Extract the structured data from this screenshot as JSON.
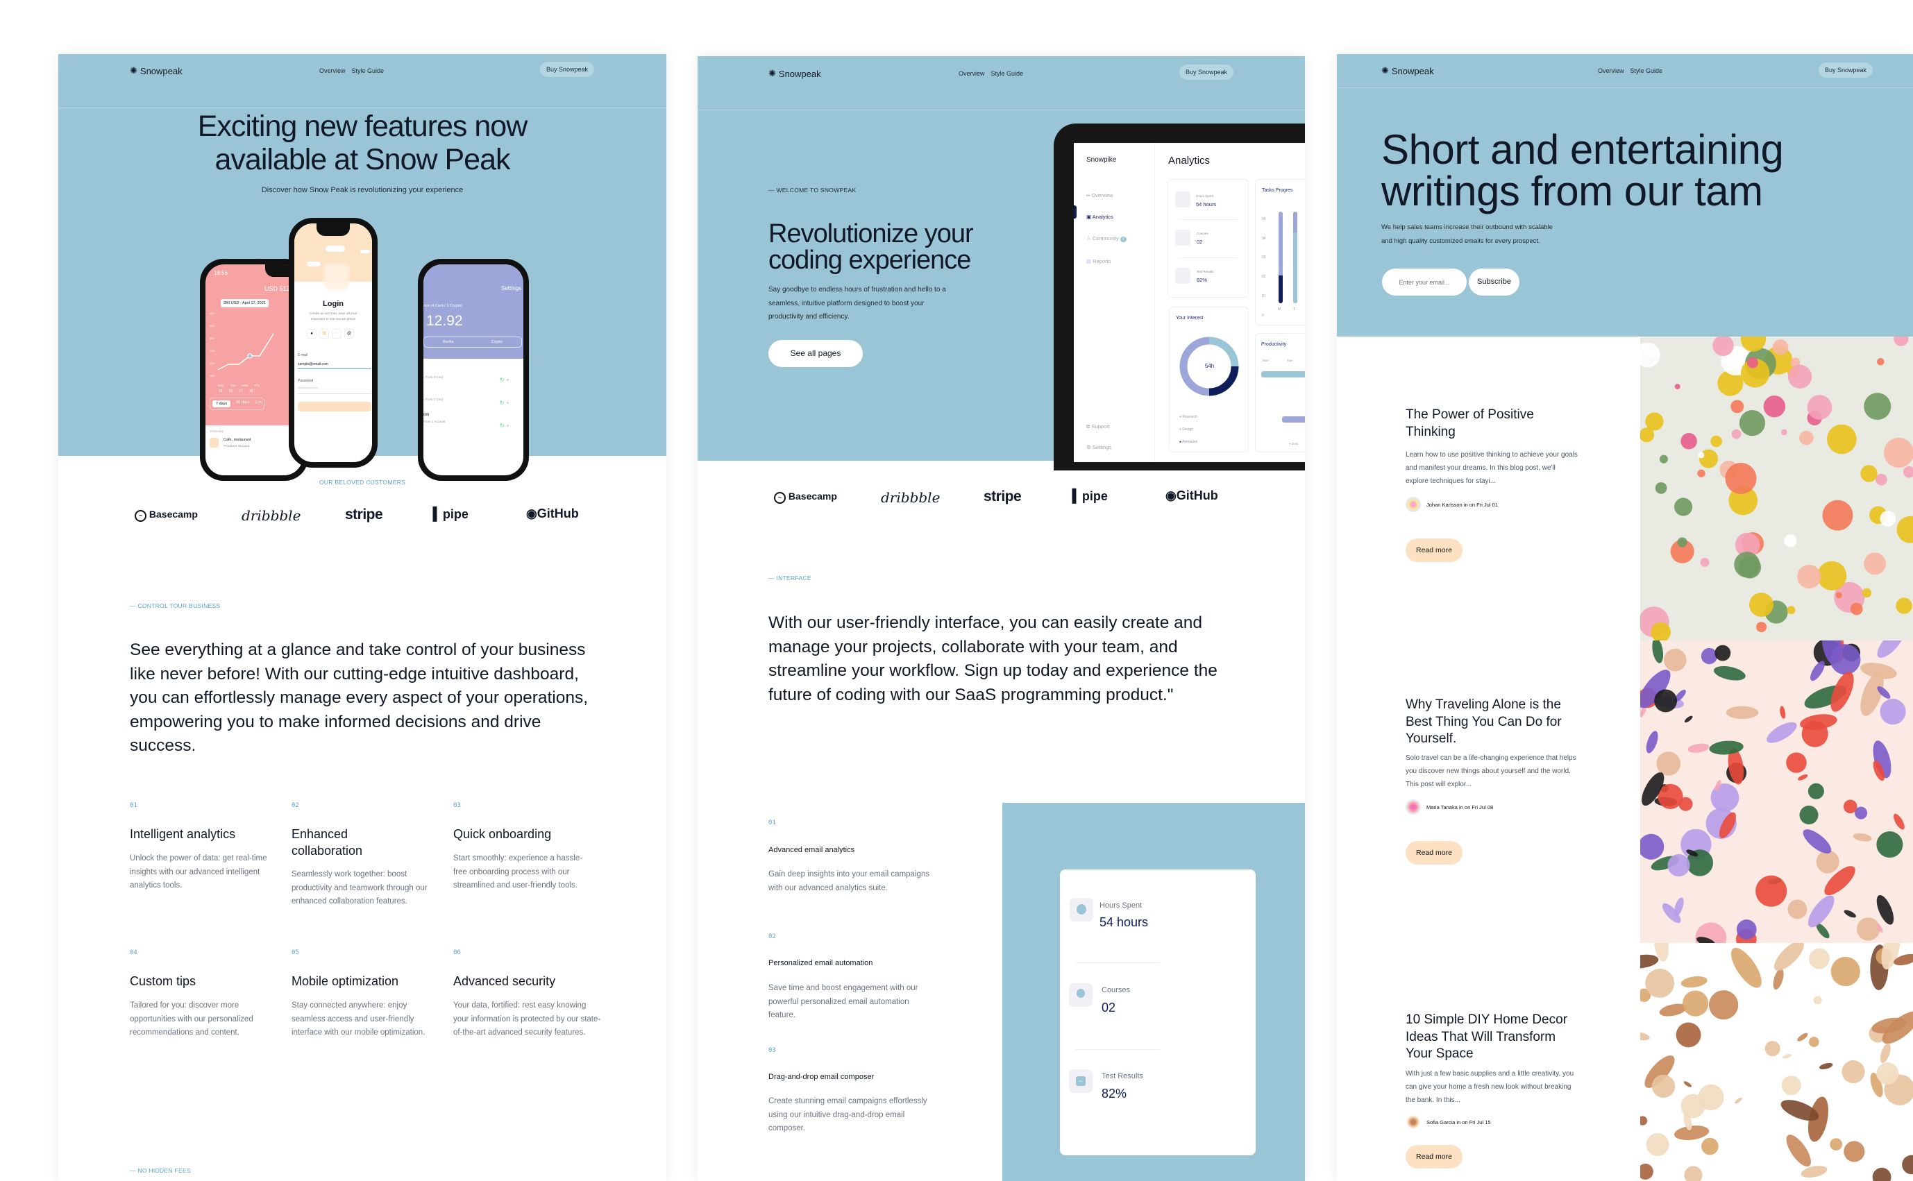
{
  "colors": {
    "brand_blue": "#9AC5D6",
    "accent_text": "#5AA3C2",
    "dark_navy": "#0F1E5A",
    "read_more_bg": "#FDE1C3"
  },
  "nav": {
    "logo": "Snowpeak",
    "links": [
      "Overview",
      "Style Guide"
    ],
    "cta": "Buy Snowpeak"
  },
  "customers": {
    "label": "OUR BELOVED CUSTOMERS",
    "logos": [
      "Basecamp",
      "dribbble",
      "stripe",
      "pipe",
      "GitHub"
    ]
  },
  "page1": {
    "hero_title_1": "Exciting new features now",
    "hero_title_2": "available at Snow Peak",
    "hero_subtitle": "Discover how Snow Peak is revolutionizing your experience",
    "phone_left": {
      "time": "18:56",
      "balance": "USD 512.92",
      "tooltip": "280 USD - April 17, 2021",
      "yticks": [
        "600",
        "500",
        "400",
        "300",
        "200",
        "100"
      ],
      "days": [
        "Mon",
        "Tue",
        "Wed",
        "Thu"
      ],
      "dates": [
        "15",
        "16",
        "17",
        "18"
      ],
      "ranges": [
        "7 days",
        "30 days",
        "1 m"
      ],
      "yesterday": "Yesterday",
      "tx_title": "Cafe, restaurant",
      "tx_sub": "PriorBank DK1214"
    },
    "phone_center": {
      "time": "18:56",
      "title": "Login",
      "subtitle_1": "Create an account, save all your",
      "subtitle_2": "expenses in one secure place!",
      "email_label": "E-mail",
      "email_value": "sample@email.com",
      "password_label": "Password",
      "password_value": "***************"
    },
    "phone_right": {
      "settings": "Settings",
      "balance_label": "nce (4 Card / 1 Crypto)",
      "balance": "12.92",
      "tabs": [
        "Banks",
        "Crypto"
      ],
      "rows": [
        "- From 3 Card",
        "- From 1 Card",
        "From 1 Account"
      ],
      "row3_title": "om"
    },
    "section_label": "— CONTROL TOUR BUSINESS",
    "section_text": "See everything at a glance and take control of your business like never before! With our cutting-edge intuitive dashboard, you can effortlessly manage every aspect of your operations, empowering you to make informed decisions and drive success.",
    "features": [
      {
        "num": "01",
        "title": "Intelligent analytics",
        "desc": "Unlock the power of data: get real-time insights with our advanced intelligent analytics tools."
      },
      {
        "num": "02",
        "title": "Enhanced collaboration",
        "desc": "Seamlessly work together: boost productivity and teamwork through our enhanced collaboration features."
      },
      {
        "num": "03",
        "title": "Quick onboarding",
        "desc": "Start smoothly: experience a hassle-free onboarding process with our streamlined and user-friendly tools."
      },
      {
        "num": "04",
        "title": "Custom tips",
        "desc": "Tailored for you: discover more opportunities with our personalized recommendations and content."
      },
      {
        "num": "05",
        "title": "Mobile optimization",
        "desc": "Stay connected anywhere: enjoy seamless access and user-friendly interface with our mobile optimization."
      },
      {
        "num": "06",
        "title": "Advanced security",
        "desc": "Your data, fortified: rest easy knowing your information is protected by our state-of-the-art advanced security features."
      }
    ],
    "footer_label": "— NO HIDDEN FEES"
  },
  "page2": {
    "eyebrow": "— WELCOME TO SNOWPEAK",
    "title_1": "Revolutionize your",
    "title_2": "coding experience",
    "desc": "Say goodbye to endless hours of frustration and hello to a seamless, intuitive platform designed to boost your productivity and efficiency.",
    "cta": "See all pages",
    "dashboard": {
      "brand": "Snowpike",
      "title": "Analytics",
      "menu": [
        {
          "label": "Overview"
        },
        {
          "label": "Analytics",
          "active": true
        },
        {
          "label": "Community",
          "badge": "2"
        },
        {
          "label": "Reports"
        }
      ],
      "menu_bottom": [
        "Support",
        "Settings"
      ],
      "stats": [
        {
          "label": "Hours Spent",
          "value": "54 hours"
        },
        {
          "label": "Courses",
          "value": "02"
        },
        {
          "label": "Test Results",
          "value": "82%"
        }
      ],
      "tasks_title": "Tasks Progres",
      "tasks_yticks": [
        "05",
        "04",
        "03",
        "02",
        "01",
        "0"
      ],
      "tasks_days": [
        "M",
        "T"
      ],
      "interest_title": "Your Interest",
      "interest_center": "54h",
      "interest_legend": [
        "Research",
        "Design",
        "Animation"
      ],
      "interest_shares": [
        0.5,
        0.25,
        0.25
      ],
      "productivity_title": "Productivity",
      "productivity_days": [
        "Mon",
        "Tue"
      ],
      "productivity_legend": "Desi"
    },
    "section_label": "— INTERFACE",
    "section_text": "With our user-friendly interface, you can easily create and manage your projects, collaborate with your team, and streamline your workflow. Sign up today and experience the future of coding with our SaaS programming product.\"",
    "features": [
      {
        "num": "01",
        "title": "Advanced email analytics",
        "desc": "Gain deep insights into your email campaigns with our advanced analytics suite."
      },
      {
        "num": "02",
        "title": "Personalized email automation",
        "desc": "Save time and boost engagement with our powerful personalized email automation feature."
      },
      {
        "num": "03",
        "title": "Drag-and-drop email composer",
        "desc": "Create stunning email campaigns effortlessly using our intuitive drag-and-drop email composer."
      }
    ],
    "stats_card": [
      {
        "label": "Hours Spent",
        "value": "54 hours",
        "icon": "alarm-clock-icon"
      },
      {
        "label": "Courses",
        "value": "02",
        "icon": "award-ribbon-icon"
      },
      {
        "label": "Test Results",
        "value": "82%",
        "icon": "chart-line-icon"
      }
    ]
  },
  "page3": {
    "title_1": "Short and entertaining",
    "title_2": "writings from our tam",
    "desc_1": "We help sales teams increase their outbound with scalable",
    "desc_2": "and high quality customized emails for every prospect.",
    "email_placeholder": "Enter your email...",
    "subscribe": "Subscribe",
    "read_more": "Read more",
    "articles": [
      {
        "title": "The Power of Positive Thinking",
        "excerpt": "Learn how to use positive thinking to achieve your goals and manifest your dreams. In this blog post, we'll explore techniques for stayi...",
        "meta": "Johan Karlsson in on Fri Jul 01"
      },
      {
        "title": "Why Traveling Alone is the Best Thing You Can Do for Yourself.",
        "excerpt": "Solo travel can be a life-changing experience that helps you discover new things about yourself and the world. This post will explor...",
        "meta": "Maria Tanaka in on Fri Jul 08"
      },
      {
        "title": "10 Simple DIY Home Decor Ideas That Will Transform Your Space",
        "excerpt": "With just a few basic supplies and a little creativity, you can give your home a fresh new look without breaking the bank. In this...",
        "meta": "Sofia Garcia in on Fri Jul 15"
      }
    ]
  }
}
